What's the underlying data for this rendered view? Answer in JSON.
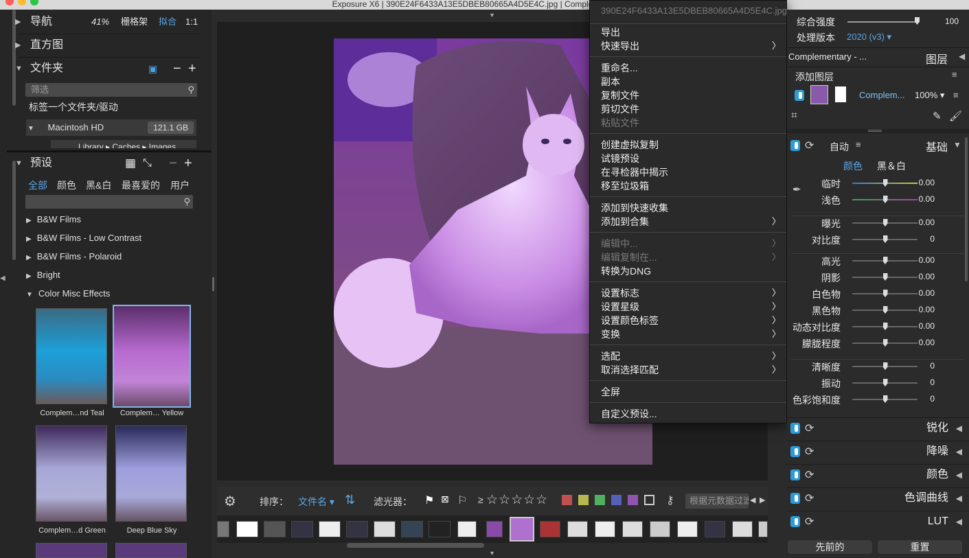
{
  "window": {
    "title": "Exposure X6 | 390E24F6433A13E5DBEB80665A4D5E4C.jpg | Complementary - ..."
  },
  "left": {
    "nav": {
      "label": "导航",
      "zoom": "41%",
      "grid": "栅格架",
      "fit": "拟合",
      "one": "1:1"
    },
    "histogram": {
      "label": "直方图"
    },
    "folders": {
      "label": "文件夹",
      "search_placeholder": "筛选",
      "tag_label": "标签一个文件夹/驱动",
      "drive_name": "Macintosh HD",
      "drive_size": "121.1 GB",
      "path": "Library ▸ Caches ▸ Images"
    },
    "presets": {
      "label": "预设",
      "tabs": [
        "全部",
        "颜色",
        "黑&白",
        "最喜爱的",
        "用户"
      ],
      "groups": [
        "B&W Films",
        "B&W Films - Low Contrast",
        "B&W Films - Polaroid",
        "Bright",
        "Color Misc Effects"
      ],
      "thumbs": [
        "Complem…nd Teal",
        "Complem… Yellow",
        "Complem…d Green",
        "Deep Blue Sky"
      ]
    }
  },
  "toolbar": {
    "sort_label": "排序：",
    "sort_value": "文件名",
    "filter_label": "滤光器：",
    "ge": "≥",
    "stars": "☆☆☆☆☆",
    "meta_placeholder": "根据元数据过滤"
  },
  "menu": {
    "filename": "390E24F6433A13E5DBEB80665A4D5E4C.jpg",
    "items": [
      {
        "label": "导出"
      },
      {
        "label": "快速导出"
      },
      {
        "label": "重命名..."
      },
      {
        "label": "副本"
      },
      {
        "label": "复制文件"
      },
      {
        "label": "剪切文件"
      },
      {
        "label": "粘贴文件"
      },
      {
        "label": "创建虚拟复制"
      },
      {
        "label": "试镜预设"
      },
      {
        "label": "在寻检器中揭示"
      },
      {
        "label": "移至垃圾箱"
      },
      {
        "label": "添加到快速收集"
      },
      {
        "label": "添加到合集"
      },
      {
        "label": "编辑中..."
      },
      {
        "label": "编辑复制在..."
      },
      {
        "label": "转换为DNG"
      },
      {
        "label": "设置标志"
      },
      {
        "label": "设置星级"
      },
      {
        "label": "设置颜色标签"
      },
      {
        "label": "变换"
      },
      {
        "label": "选配"
      },
      {
        "label": "取消选择匹配"
      },
      {
        "label": "全屏"
      },
      {
        "label": "自定义预设..."
      }
    ]
  },
  "right": {
    "intensity": {
      "label": "综合强度",
      "value": "100"
    },
    "version": {
      "label": "处理版本",
      "value": "2020 (v3)"
    },
    "layers": {
      "preset_name": "Complementary - ...",
      "title": "图层",
      "add_label": "添加图层",
      "layer_name": "Complem...",
      "opacity": "100%"
    },
    "basic": {
      "auto": "自动",
      "title": "基础",
      "mode_color": "颜色",
      "mode_bw": "黑＆白",
      "sliders": [
        {
          "label": "临时",
          "value": "0.00",
          "pos": 0.5
        },
        {
          "label": "浅色",
          "value": "0.00",
          "pos": 0.5
        },
        {
          "label": "曝光",
          "value": "0.00",
          "pos": 0.5
        },
        {
          "label": "对比度",
          "value": "0",
          "pos": 0.5
        },
        {
          "label": "高光",
          "value": "0.00",
          "pos": 0.5
        },
        {
          "label": "阴影",
          "value": "0.00",
          "pos": 0.5
        },
        {
          "label": "白色物",
          "value": "0.00",
          "pos": 0.5
        },
        {
          "label": "黑色物",
          "value": "0.00",
          "pos": 0.5
        },
        {
          "label": "动态对比度",
          "value": "0.00",
          "pos": 0.5
        },
        {
          "label": "朦胧程度",
          "value": "0.00",
          "pos": 0.5
        },
        {
          "label": "清晰度",
          "value": "0",
          "pos": 0.5
        },
        {
          "label": "振动",
          "value": "0",
          "pos": 0.5
        },
        {
          "label": "色彩饱和度",
          "value": "0",
          "pos": 0.5
        }
      ]
    },
    "sections": [
      "锐化",
      "降噪",
      "颜色",
      "色调曲线",
      "LUT"
    ],
    "prev_button": "先前的",
    "reset_button": "重置"
  }
}
